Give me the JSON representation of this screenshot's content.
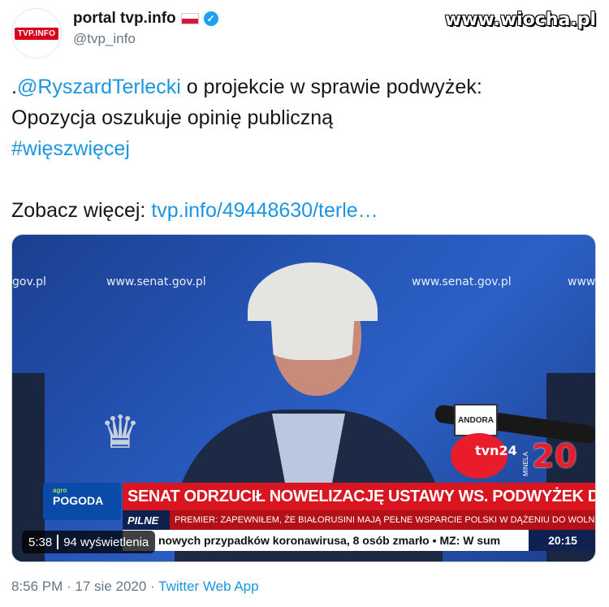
{
  "account": {
    "display_name": "portal tvp.info",
    "handle": "@tvp_info",
    "avatar_text": "TVP.INFO",
    "flag_icon": "poland-flag-icon",
    "verified_icon": "verified-badge-icon"
  },
  "watermark": "www.wiocha.pl",
  "tweet": {
    "line1_prefix": ".",
    "line1_mention": "@RyszardTerlecki",
    "line1_rest": " o projekcie w sprawie podwyżek:",
    "line2": "Opozycja oszukuje opinię publiczną",
    "hashtag": "#więszwięcej",
    "see_more_label": "Zobacz więcej: ",
    "see_more_link": "tvp.info/49448630/terle…"
  },
  "video": {
    "backdrop_left": "gov.pl",
    "backdrop_center_left": "www.senat.gov.pl",
    "backdrop_center_right": "www.senat.gov.pl",
    "backdrop_right": "www",
    "mic_brand": "ANDORA",
    "mic_logo": "tvn24",
    "channel_label": "MINELA",
    "channel_number": "20",
    "weather_small": "agro",
    "weather_label": "POGODA",
    "headline": "SENAT ODRZUCIŁ NOWELIZACJĘ USTAWY WS. PODWYŻEK DLA POLITYKÓW",
    "pilne_label": "PILNE",
    "pilne_text": "PREMIER: ZAPEWNIŁEM, ŻE BIAŁORUSINI MAJĄ PEŁNE WSPARCIE POLSKI W DĄŻENIU DO WOLNOŚCI OJCZYZNY",
    "ticker": "nowych przypadków koronawirusa, 8 osób zmarło ▪ MZ: W sum",
    "clock": "20:15",
    "duration": "5:38",
    "views": "94 wyświetlenia"
  },
  "footer": {
    "timestamp": "8:56 PM · 17 sie 2020 · ",
    "source": "Twitter Web App"
  }
}
